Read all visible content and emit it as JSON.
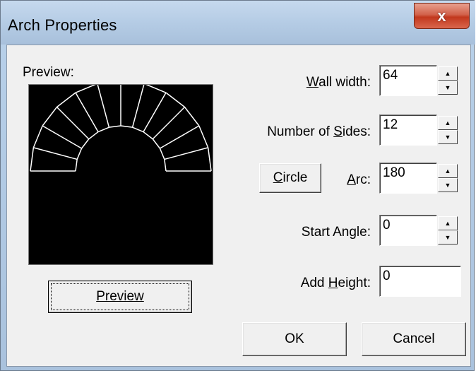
{
  "window": {
    "title": "Arch Properties",
    "close_symbol": "x"
  },
  "preview": {
    "label": "Preview:",
    "button_label": "Preview"
  },
  "fields": {
    "wall_width": {
      "label_pre": "",
      "label_ul": "W",
      "label_post": "all width:",
      "value": "64"
    },
    "number_of_sides": {
      "label_pre": "Number of ",
      "label_ul": "S",
      "label_post": "ides:",
      "value": "12"
    },
    "arc": {
      "label_pre": "",
      "label_ul": "A",
      "label_post": "rc:",
      "value": "180"
    },
    "start_angle": {
      "label_pre": "Start Angle:",
      "label_ul": "",
      "label_post": "",
      "value": "0"
    },
    "add_height": {
      "label_pre": "Add ",
      "label_ul": "H",
      "label_post": "eight:",
      "value": "0"
    }
  },
  "circle_button": {
    "label_ul": "C",
    "label_post": "ircle"
  },
  "ok_label": "OK",
  "cancel_label": "Cancel",
  "spin_up": "▲",
  "spin_down": "▼",
  "arch": {
    "sides": 12,
    "arc_degrees": 180,
    "line_color": "#ffffff"
  }
}
